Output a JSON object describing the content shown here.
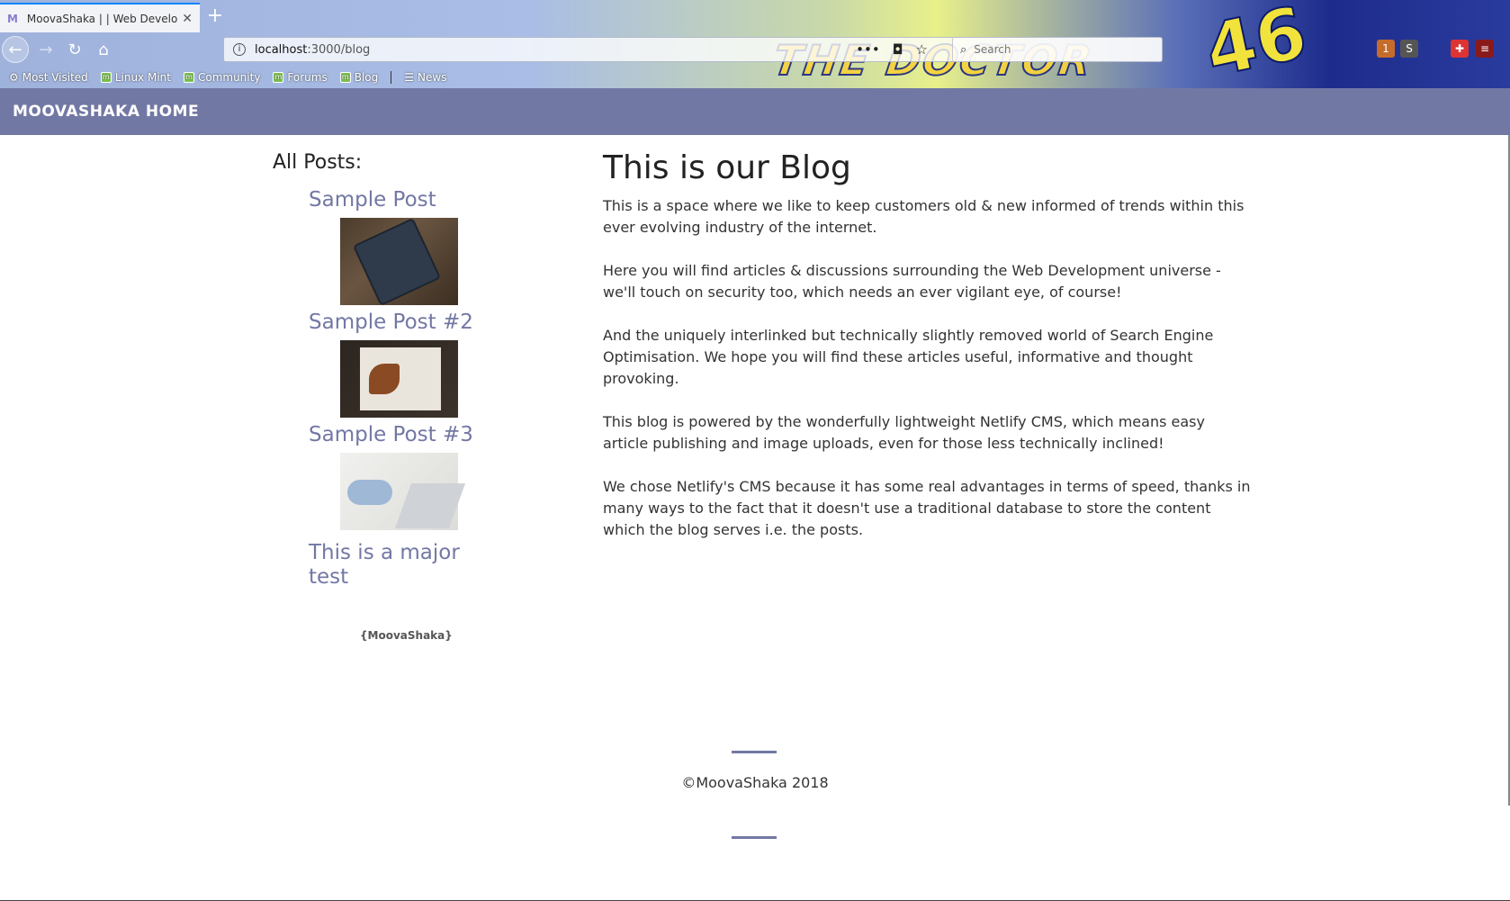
{
  "browser": {
    "tab_title": "MoovaShaka | | Web Develop",
    "tab_favicon": "M",
    "url_host": "localhost",
    "url_path": ":3000/blog",
    "search_placeholder": "Search",
    "theme_text": "THE DOCTOR",
    "theme_number": "46",
    "bookmarks": [
      {
        "label": "Most Visited",
        "icon": "gear-icon"
      },
      {
        "label": "Linux Mint",
        "icon": "mint-icon"
      },
      {
        "label": "Community",
        "icon": "mint-icon"
      },
      {
        "label": "Forums",
        "icon": "mint-icon"
      },
      {
        "label": "Blog",
        "icon": "mint-icon"
      },
      {
        "label": "News",
        "icon": "rss-icon"
      }
    ],
    "extension_badge": "1"
  },
  "site": {
    "nav_home": "MOOVASHAKA HOME"
  },
  "sidebar": {
    "heading": "All Posts:",
    "posts": [
      {
        "title": "Sample Post"
      },
      {
        "title": "Sample Post #2"
      },
      {
        "title": "Sample Post #3"
      },
      {
        "title": "This is a major test"
      }
    ],
    "brand": "{MoovaShaka}"
  },
  "main": {
    "title": "This is our Blog",
    "paragraphs": [
      "This is a space where we like to keep customers old & new informed of trends within this ever evolving industry of the internet.",
      "Here you will find articles & discussions surrounding the Web Development universe - we'll touch on security too, which needs an ever vigilant eye, of course!",
      "And the uniquely interlinked but technically slightly removed world of Search Engine Optimisation. We hope you will find these articles useful, informative and thought provoking.",
      "This blog is powered by the wonderfully lightweight Netlify CMS, which means easy article publishing and image uploads, even for those less technically inclined!",
      "We chose Netlify's CMS because it has some real advantages in terms of speed, thanks in many ways to the fact that it doesn't use a traditional database to store the content which the blog serves i.e. the posts."
    ]
  },
  "footer": {
    "copyright": "©MoovaShaka 2018"
  },
  "colors": {
    "accent": "#7278a4",
    "text": "#333333"
  }
}
